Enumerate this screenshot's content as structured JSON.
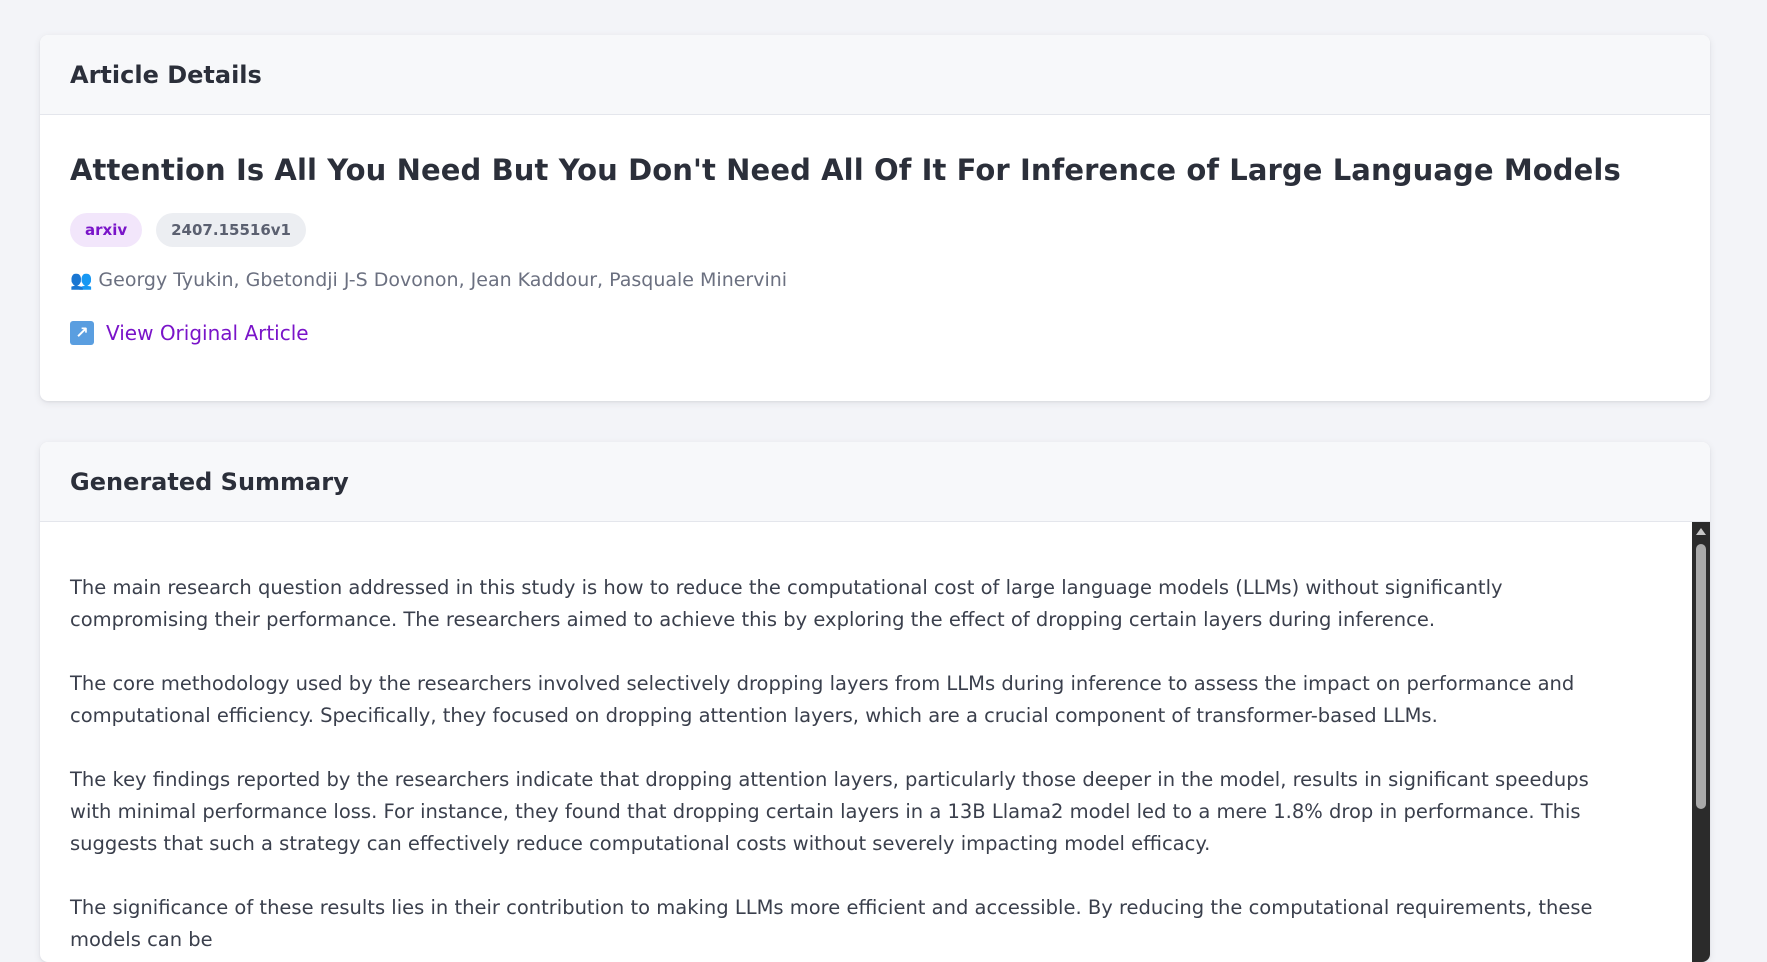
{
  "details": {
    "header": "Article Details",
    "title": "Attention Is All You Need But You Don't Need All Of It For Inference of Large Language Models",
    "source_badge": "arxiv",
    "id_badge": "2407.15516v1",
    "authors_icon": "👥",
    "authors": "Georgy Tyukin, Gbetondji J-S Dovonon, Jean Kaddour, Pasquale Minervini",
    "link_icon": "↗",
    "link_label": "View Original Article"
  },
  "summary": {
    "header": "Generated Summary",
    "paragraphs": [
      "The main research question addressed in this study is how to reduce the computational cost of large language models (LLMs) without significantly compromising their performance. The researchers aimed to achieve this by exploring the effect of dropping certain layers during inference.",
      "The core methodology used by the researchers involved selectively dropping layers from LLMs during inference to assess the impact on performance and computational efficiency. Specifically, they focused on dropping attention layers, which are a crucial component of transformer-based LLMs.",
      "The key findings reported by the researchers indicate that dropping attention layers, particularly those deeper in the model, results in significant speedups with minimal performance loss. For instance, they found that dropping certain layers in a 13B Llama2 model led to a mere 1.8% drop in performance. This suggests that such a strategy can effectively reduce computational costs without severely impacting model efficacy.",
      "The significance of these results lies in their contribution to making LLMs more efficient and accessible. By reducing the computational requirements, these models can be"
    ]
  },
  "colors": {
    "accent": "#7a14c9",
    "badge_source_bg": "#f2e6fb",
    "badge_id_bg": "#eceef2",
    "page_bg": "#f3f4f8"
  }
}
